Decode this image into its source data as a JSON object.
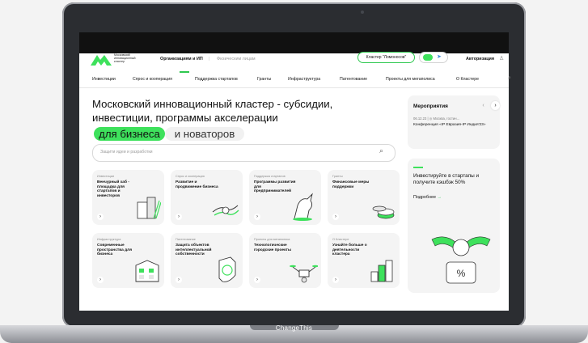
{
  "caption": "ChangeThis",
  "header": {
    "logo_text": "Московский инновационный кластер",
    "audience_active": "Организациям и ИП",
    "audience_other": "Физическим лицам",
    "cluster_label": "Кластер \"Ломоносов\"",
    "auth_label": "Авторизация"
  },
  "nav": [
    "Инвестиции",
    "Спрос и кооперация",
    "Поддержка стартапов",
    "Гранты",
    "Инфраструктура",
    "Патентование",
    "Проекты для мегаполиса",
    "О Кластере"
  ],
  "hero": {
    "title": "Московский инновационный кластер - субсидии, инвестиции, программы акселерации",
    "badge": "для бизнеса",
    "rest": "и новаторов",
    "search_placeholder": "Защити идеи и разработки"
  },
  "cards": [
    {
      "category": "Инвестиции",
      "title": "Венчурный хаб - площадка для стартапов и инвесторов"
    },
    {
      "category": "Спрос и кооперация",
      "title": "Развитие и продвижение бизнеса"
    },
    {
      "category": "Поддержка стартапов",
      "title": "Программы развития для предпринимателей"
    },
    {
      "category": "Гранты",
      "title": "Финансовые меры поддержки"
    },
    {
      "category": "Инфраструктура",
      "title": "Современные пространства для бизнеса"
    },
    {
      "category": "Патентование",
      "title": "Защита объектов интеллектуальной собственности"
    },
    {
      "category": "Проекты для мегаполиса",
      "title": "Технологические городские проекты"
    },
    {
      "category": "О Кластере",
      "title": "Узнайте больше о деятельности кластера"
    }
  ],
  "events": {
    "title": "Мероприятия",
    "meta": "06.12.23 | ◎ Москва, гостин...",
    "name": "Конференция «IP Евразия-IP Индия'23»"
  },
  "promo": {
    "text": "Инвестируйте в стартапы и получите кэшбэк 50%",
    "more": "Подробнее"
  },
  "colors": {
    "accent": "#3ee15c",
    "card_bg": "#f4f4f4"
  }
}
